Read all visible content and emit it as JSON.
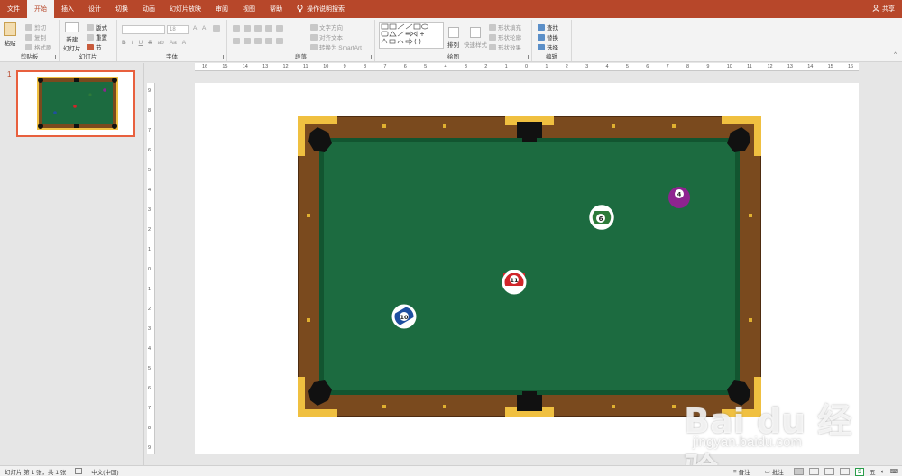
{
  "tabs": [
    {
      "label": "文件",
      "active": false
    },
    {
      "label": "开始",
      "active": true
    },
    {
      "label": "插入",
      "active": false
    },
    {
      "label": "设计",
      "active": false
    },
    {
      "label": "切换",
      "active": false
    },
    {
      "label": "动画",
      "active": false
    },
    {
      "label": "幻灯片放映",
      "active": false
    },
    {
      "label": "审阅",
      "active": false
    },
    {
      "label": "视图",
      "active": false
    },
    {
      "label": "帮助",
      "active": false
    }
  ],
  "search_label": "操作说明搜索",
  "share_label": "共享",
  "ribbon": {
    "clipboard": {
      "label": "剪贴板",
      "paste": "粘贴",
      "cut": "剪切",
      "copy": "复制",
      "format_painter": "格式刷"
    },
    "slides": {
      "label": "幻灯片",
      "new_slide": "新建",
      "new_slide2": "幻灯片",
      "layout": "版式",
      "reset": "重置",
      "section": "节"
    },
    "font": {
      "label": "字体",
      "font_size": "18"
    },
    "paragraph": {
      "label": "段落",
      "text_direction": "文字方向",
      "align_text": "对齐文本",
      "smartart": "转换为 SmartArt"
    },
    "drawing": {
      "label": "绘图",
      "arrange": "排列",
      "quick_styles": "快速样式",
      "shape_fill": "形状填充",
      "shape_outline": "形状轮廓",
      "shape_effects": "形状效果"
    },
    "editing": {
      "label": "编辑",
      "find": "查找",
      "replace": "替换",
      "select": "选择"
    }
  },
  "thumbnail": {
    "number": "1"
  },
  "ruler_h_labels": [
    "16",
    "15",
    "14",
    "13",
    "12",
    "11",
    "10",
    "9",
    "8",
    "7",
    "6",
    "5",
    "4",
    "3",
    "2",
    "1",
    "0",
    "1",
    "2",
    "3",
    "4",
    "5",
    "6",
    "7",
    "8",
    "9",
    "10",
    "11",
    "12",
    "13",
    "14",
    "15",
    "16"
  ],
  "ruler_v_labels": [
    "9",
    "8",
    "7",
    "6",
    "5",
    "4",
    "3",
    "2",
    "1",
    "0",
    "1",
    "2",
    "3",
    "4",
    "5",
    "6",
    "7",
    "8",
    "9"
  ],
  "balls": [
    {
      "number": "4",
      "color": "#8e2490",
      "kind": "solid"
    },
    {
      "number": "6",
      "color": "#2d7a3a",
      "kind": "stripe"
    },
    {
      "number": "11",
      "color": "#d0252a",
      "kind": "stripe"
    },
    {
      "number": "10",
      "color": "#1f4fa0",
      "kind": "stripe"
    }
  ],
  "colors": {
    "accent": "#b7472a",
    "felt": "#1c6b40",
    "felt_edge": "#125530",
    "rail": "#7a4a1e",
    "corner": "#f0c040",
    "pocket": "#111111"
  },
  "status": {
    "slide_info": "幻灯片 第 1 张，共 1 张",
    "language": "中文(中国)",
    "notes": "备注",
    "comments": "批注",
    "ime": "五"
  },
  "watermark": {
    "brand": "Bai du 经验",
    "url": "jingyan.baidu.com"
  }
}
